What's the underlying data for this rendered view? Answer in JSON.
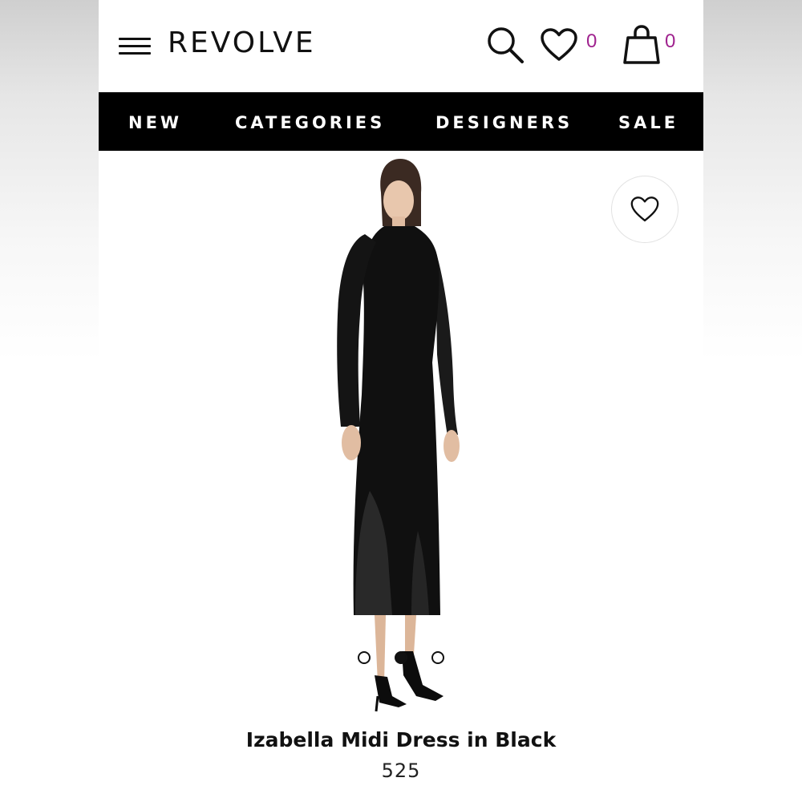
{
  "header": {
    "menu_icon": "hamburger-menu-icon",
    "logo": "REVOLVE",
    "search_icon": "search-icon",
    "wishlist_icon": "heart-icon",
    "wishlist_count": "0",
    "bag_icon": "shopping-bag-icon",
    "bag_count": "0",
    "count_color": "#a0238f"
  },
  "nav": {
    "items": [
      {
        "label": "NEW"
      },
      {
        "label": "CATEGORIES"
      },
      {
        "label": "DESIGNERS"
      },
      {
        "label": "SALE"
      }
    ]
  },
  "product": {
    "image": "model-in-black-knit-midi-dress",
    "favorite_icon": "heart-icon",
    "carousel": {
      "count": 3,
      "active_index": 1
    },
    "name": "Izabella Midi Dress in Black",
    "price": "525"
  }
}
